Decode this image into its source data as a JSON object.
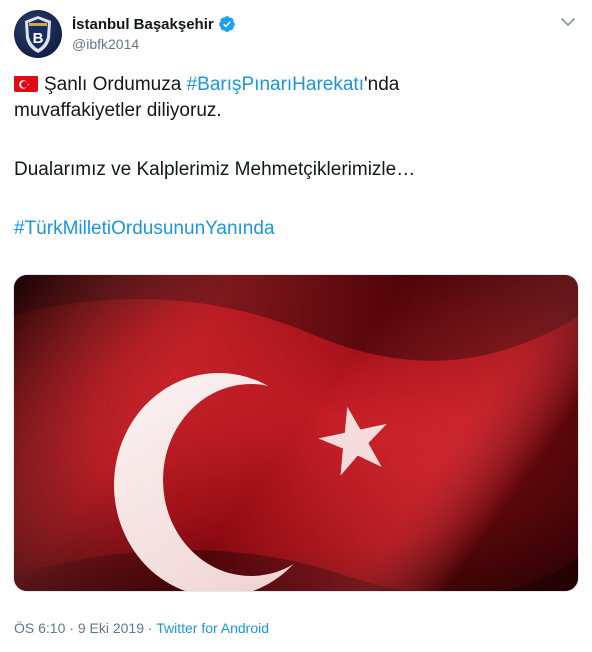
{
  "author": {
    "display_name": "İstanbul Başakşehir",
    "handle": "@ibfk2014",
    "verified": true,
    "avatar_icon": "club-crest-icon",
    "avatar_letter": "B"
  },
  "tweet": {
    "line1_flag": "turkey-flag-emoji",
    "line1_prefix": "Şanlı Ordumuza ",
    "line1_hashtag": "#BarışPınarıHarekatı",
    "line1_suffix": "'nda",
    "line2": "muvaffakiyetler diliyoruz.",
    "line3": "Dualarımız ve Kalplerimiz Mehmetçiklerimizle…",
    "line4_hashtag": "#TürkMilletiOrdusununYanında"
  },
  "media": {
    "type": "image",
    "subject": "turkish-flag-image"
  },
  "meta": {
    "time": "ÖS 6:10",
    "separator1": " · ",
    "date": "9 Eki 2019",
    "separator2": " · ",
    "source": "Twitter for Android"
  },
  "colors": {
    "link": "#1b95e0",
    "muted": "#657786",
    "verified": "#1da1f2",
    "flag_red": "#e30a17"
  }
}
